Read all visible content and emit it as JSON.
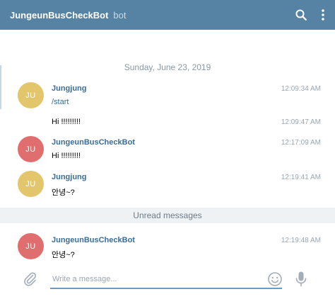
{
  "header": {
    "title": "JungeunBusCheckBot",
    "subtitle": "bot",
    "icons": [
      "search-icon",
      "more-vertical-icon"
    ]
  },
  "date_separator": "Sunday, June 23, 2019",
  "messages": [
    {
      "avatar_initials": "JU",
      "avatar_color": "#e3c66b",
      "sender": "Jungjung",
      "text": "/start",
      "time": "12:09:34 AM"
    },
    {
      "text": "Hi !!!!!!!!!",
      "time": "12:09:47 AM"
    },
    {
      "avatar_initials": "JU",
      "avatar_color": "#e16e6e",
      "sender": "JungeunBusCheckBot",
      "text": "Hi !!!!!!!!!",
      "time": "12:17:09 AM"
    },
    {
      "avatar_initials": "JU",
      "avatar_color": "#e3c66b",
      "sender": "Jungjung",
      "text": "안녕~?",
      "time": "12:19:41 AM"
    },
    {
      "avatar_initials": "JU",
      "avatar_color": "#e16e6e",
      "sender": "JungeunBusCheckBot",
      "text": "안녕~?",
      "time": "12:19:48 AM"
    }
  ],
  "unread_label": "Unread messages",
  "composer": {
    "placeholder": "Write a message...",
    "icons": [
      "attach-icon",
      "emoji-icon",
      "microphone-icon"
    ]
  },
  "colors": {
    "header_bg": "#5682a3",
    "sender_name": "#3a6d99",
    "input_underline": "#6a9bc3"
  }
}
